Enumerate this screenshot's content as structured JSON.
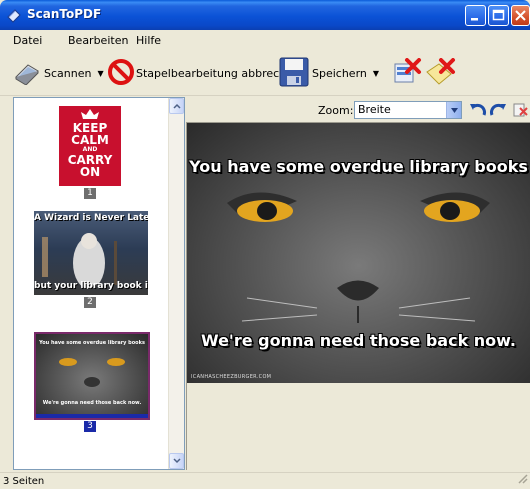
{
  "window": {
    "title": "ScanToPDF"
  },
  "menu": {
    "items": [
      "Datei",
      "Bearbeiten",
      "Hilfe"
    ]
  },
  "toolbar": {
    "scan_label": "Scannen",
    "cancel_batch_label": "Stapelbearbeitung abbrechen",
    "save_label": "Speichern"
  },
  "thumbnails": [
    {
      "number": "1",
      "lines": [
        "KEEP",
        "CALM",
        "AND",
        "CARRY",
        "ON"
      ],
      "selected": false
    },
    {
      "number": "2",
      "top_text": "A Wizard is Never Late...",
      "bottom_text": "but your library book is",
      "selected": false
    },
    {
      "number": "3",
      "top_text": "You have some overdue library books",
      "bottom_text": "We're gonna need those back now.",
      "selected": true
    }
  ],
  "viewer": {
    "zoom_label": "Zoom:",
    "zoom_value": "Breite",
    "image_top_text": "You have some overdue library books",
    "image_bottom_text": "We're gonna need those back now.",
    "watermark": "ICANHASCHEEZBURGER.COM"
  },
  "status": {
    "text": "3 Seiten"
  },
  "colors": {
    "title_bar": "#0b52d6",
    "selected_thumb": "#1a2aa8",
    "keep_calm_red": "#c8102e"
  }
}
